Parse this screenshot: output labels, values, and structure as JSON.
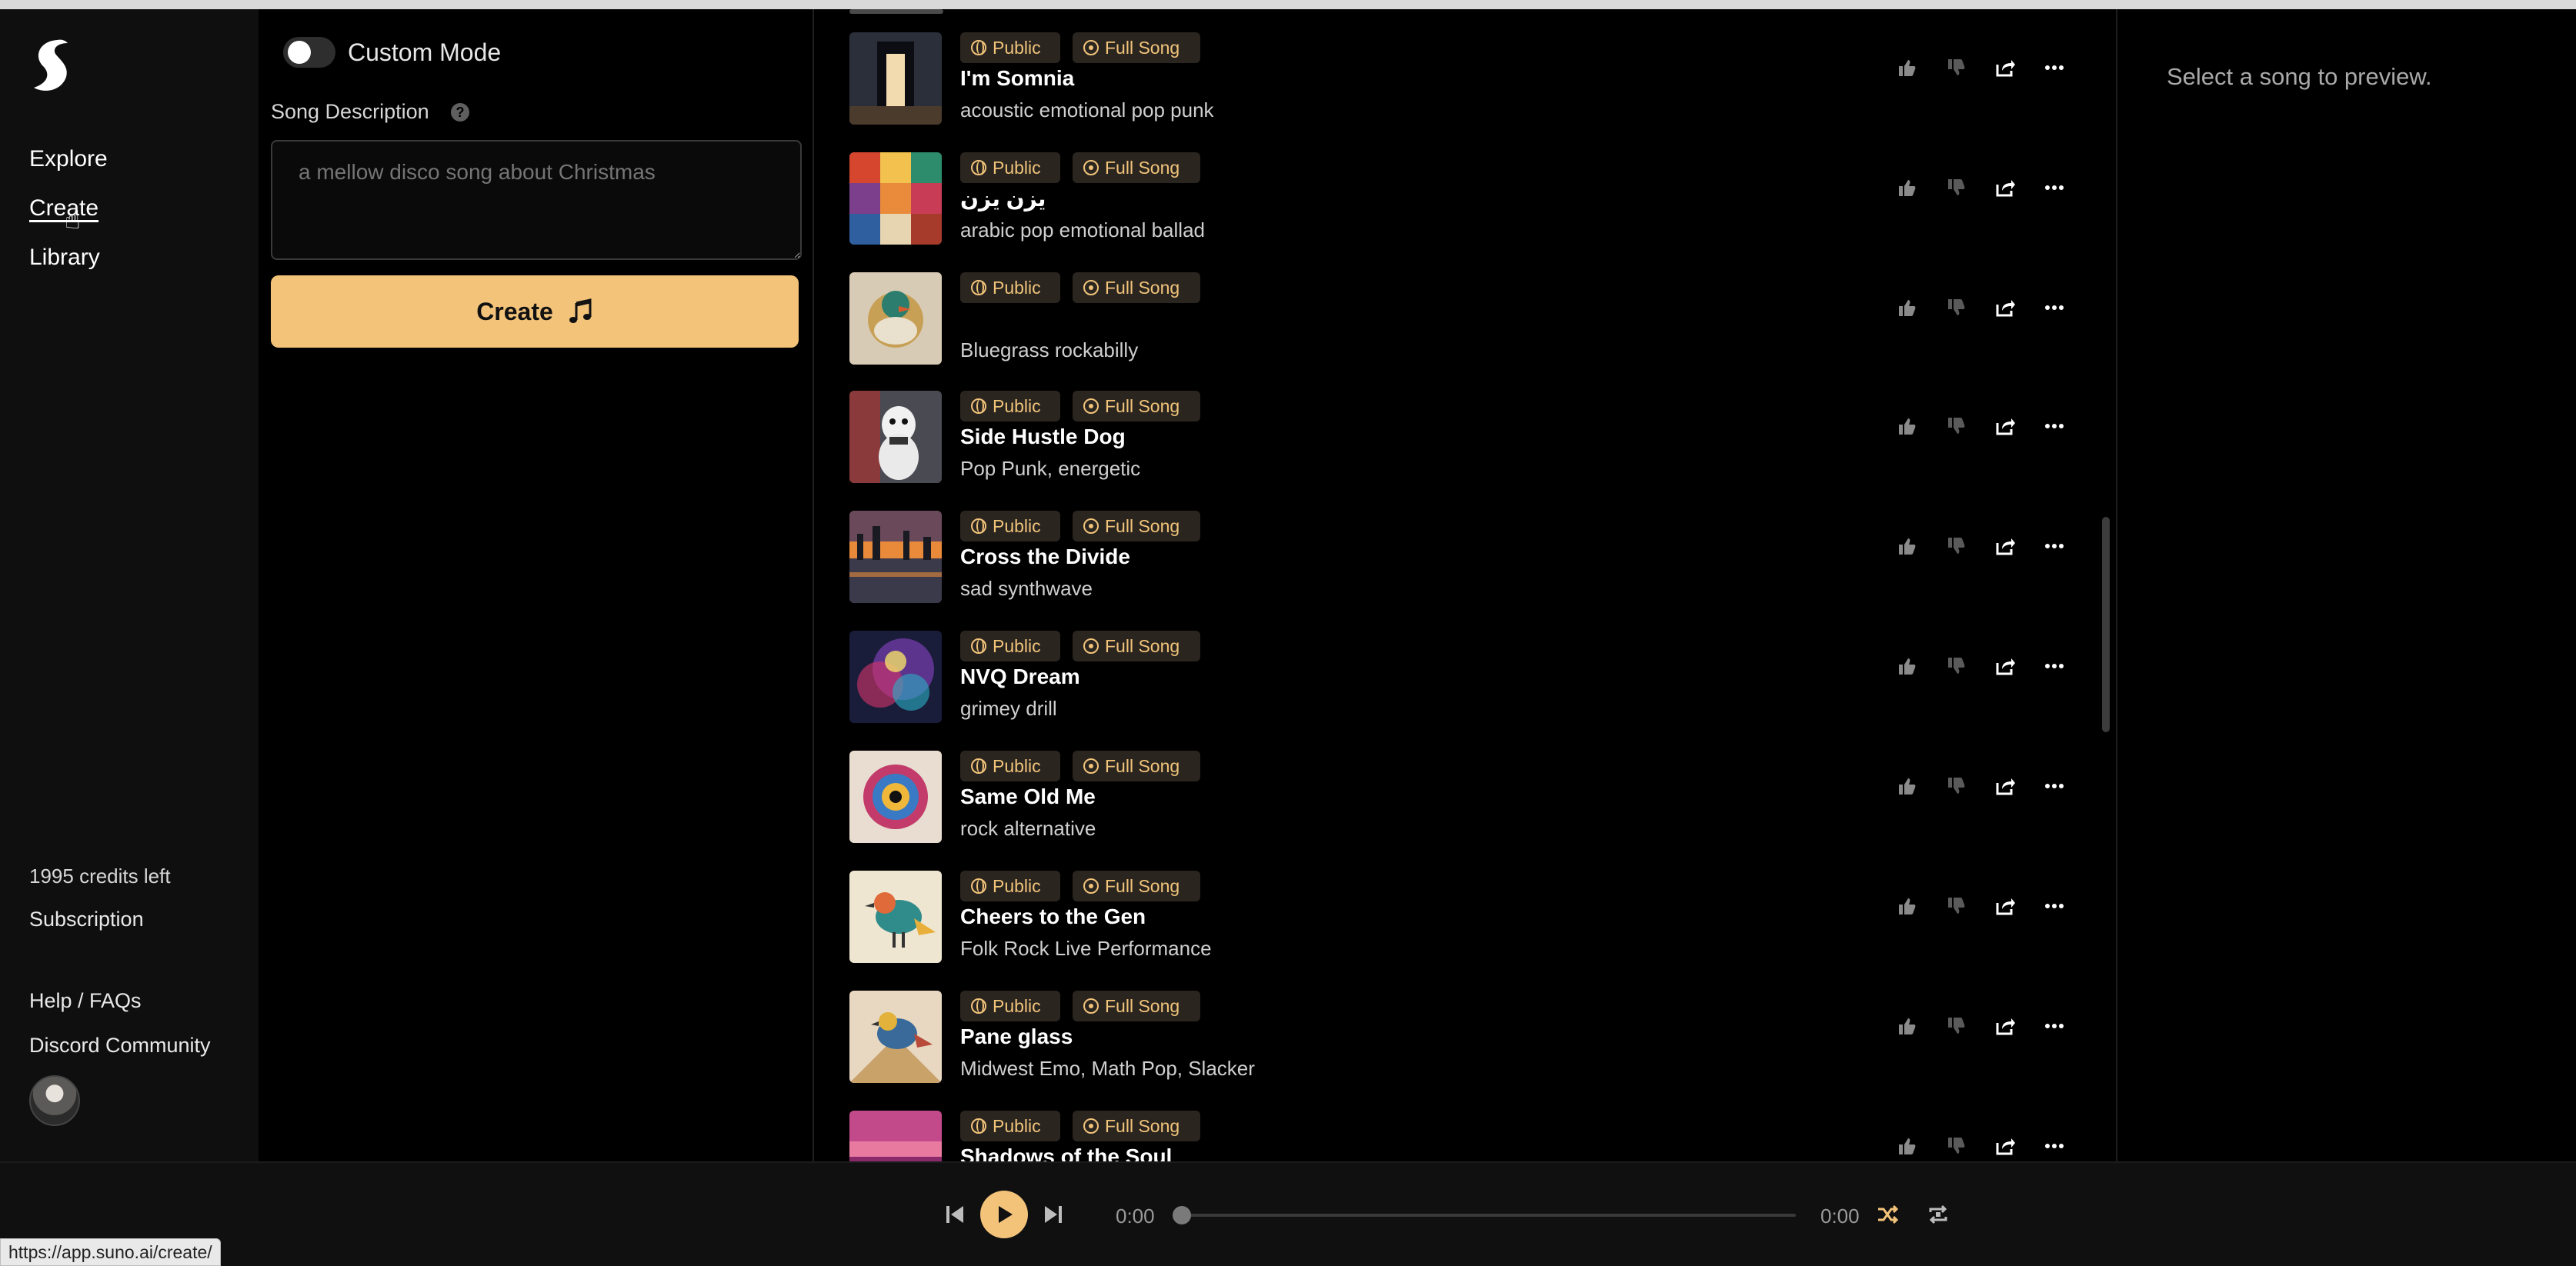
{
  "nav": {
    "links": [
      "Explore",
      "Create",
      "Library"
    ],
    "credits": "1995 credits left",
    "subscription": "Subscription",
    "help": "Help / FAQs",
    "discord": "Discord Community"
  },
  "create_panel": {
    "custom_mode_label": "Custom Mode",
    "custom_mode_on": false,
    "description_label": "Song Description",
    "description_placeholder": "a mellow disco song about Christmas",
    "create_button": "Create"
  },
  "songs": [
    {
      "title": "I'm Somnia",
      "style": "acoustic emotional pop punk",
      "visibility": "Public",
      "kind": "Full Song",
      "thumb": "door"
    },
    {
      "title": "يزن يزن",
      "style": "arabic pop emotional ballad",
      "visibility": "Public",
      "kind": "Full Song",
      "thumb": "mosaic"
    },
    {
      "title": "",
      "style": "Bluegrass rockabilly",
      "visibility": "Public",
      "kind": "Full Song",
      "thumb": "duck"
    },
    {
      "title": "Side Hustle Dog",
      "style": "Pop Punk, energetic",
      "visibility": "Public",
      "kind": "Full Song",
      "thumb": "dog"
    },
    {
      "title": "Cross the Divide",
      "style": "sad synthwave",
      "visibility": "Public",
      "kind": "Full Song",
      "thumb": "sunset"
    },
    {
      "title": "NVQ Dream",
      "style": "grimey drill",
      "visibility": "Public",
      "kind": "Full Song",
      "thumb": "nebula"
    },
    {
      "title": "Same Old Me",
      "style": "rock alternative",
      "visibility": "Public",
      "kind": "Full Song",
      "thumb": "burst"
    },
    {
      "title": "Cheers to the Gen",
      "style": "Folk Rock Live Performance",
      "visibility": "Public",
      "kind": "Full Song",
      "thumb": "bird"
    },
    {
      "title": "Pane glass",
      "style": "Midwest Emo, Math Pop, Slacker",
      "visibility": "Public",
      "kind": "Full Song",
      "thumb": "bird2"
    },
    {
      "title": "Shadows of the Soul",
      "style": "",
      "visibility": "Public",
      "kind": "Full Song",
      "thumb": "pink"
    }
  ],
  "preview": {
    "placeholder": "Select a song to preview."
  },
  "player": {
    "current_time": "0:00",
    "duration": "0:00",
    "progress": 0
  },
  "status_url": "https://app.suno.ai/create/",
  "colors": {
    "accent": "#f3c37a",
    "badge_text": "#f1c47a",
    "badge_bg": "#2b2520"
  }
}
